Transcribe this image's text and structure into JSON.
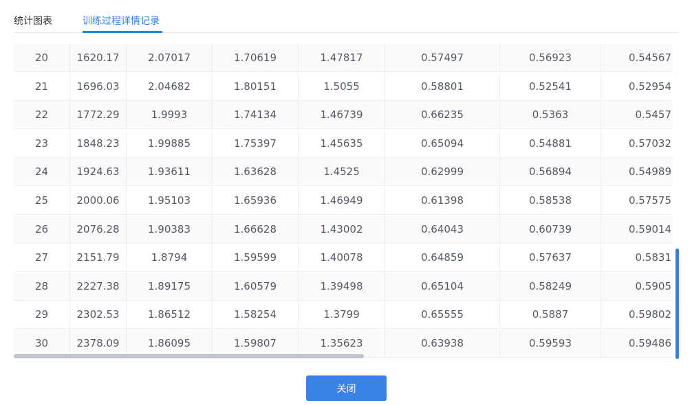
{
  "tabs": [
    {
      "label": "统计图表"
    },
    {
      "label": "训练过程详情记录"
    }
  ],
  "table": {
    "rows": [
      [
        "20",
        "1620.17",
        "2.07017",
        "1.70619",
        "1.47817",
        "0.57497",
        "0.56923",
        "0.54567"
      ],
      [
        "21",
        "1696.03",
        "2.04682",
        "1.80151",
        "1.5055",
        "0.58801",
        "0.52541",
        "0.52954"
      ],
      [
        "22",
        "1772.29",
        "1.9993",
        "1.74134",
        "1.46739",
        "0.66235",
        "0.5363",
        "0.5457"
      ],
      [
        "23",
        "1848.23",
        "1.99885",
        "1.75397",
        "1.45635",
        "0.65094",
        "0.54881",
        "0.57032"
      ],
      [
        "24",
        "1924.63",
        "1.93611",
        "1.63628",
        "1.4525",
        "0.62999",
        "0.56894",
        "0.54989"
      ],
      [
        "25",
        "2000.06",
        "1.95103",
        "1.65936",
        "1.46949",
        "0.61398",
        "0.58538",
        "0.57575"
      ],
      [
        "26",
        "2076.28",
        "1.90383",
        "1.66628",
        "1.43002",
        "0.64043",
        "0.60739",
        "0.59014"
      ],
      [
        "27",
        "2151.79",
        "1.8794",
        "1.59599",
        "1.40078",
        "0.64859",
        "0.57637",
        "0.5831"
      ],
      [
        "28",
        "2227.38",
        "1.89175",
        "1.60579",
        "1.39498",
        "0.65104",
        "0.58249",
        "0.5905"
      ],
      [
        "29",
        "2302.53",
        "1.86512",
        "1.58254",
        "1.3799",
        "0.65555",
        "0.5887",
        "0.59802"
      ],
      [
        "30",
        "2378.09",
        "1.86095",
        "1.59807",
        "1.35623",
        "0.63938",
        "0.59593",
        "0.59486"
      ]
    ]
  },
  "footer": {
    "close_label": "关闭"
  },
  "colors": {
    "accent": "#3a82e6",
    "active_tab": "#2f80e4"
  }
}
